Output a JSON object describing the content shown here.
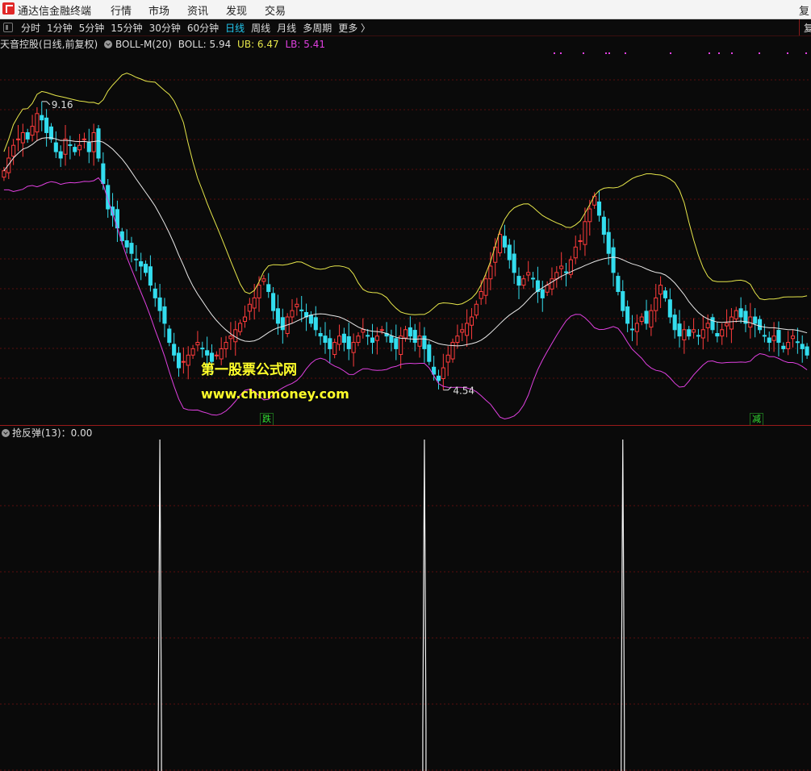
{
  "menu": {
    "app_title": "通达信金融终端",
    "items": [
      "行情",
      "市场",
      "资讯",
      "发现",
      "交易"
    ],
    "right_edge": "复"
  },
  "periods": {
    "items": [
      "分时",
      "1分钟",
      "5分钟",
      "15分钟",
      "30分钟",
      "60分钟",
      "日线",
      "周线",
      "月线",
      "多周期",
      "更多 〉"
    ],
    "active": "日线",
    "right_mark": "复"
  },
  "main": {
    "stock_label": "天音控股(日线,前复权)",
    "indicator": "BOLL-M(20)",
    "boll": "BOLL: 5.94",
    "ub": "UB: 6.47",
    "lb": "LB: 5.41",
    "high_label": "9.16",
    "low_label": "4.54",
    "signal_a": "跌",
    "signal_b": "减",
    "colors": {
      "up": "#ff3c3c",
      "down": "#33ddee",
      "mid": "#e8e8e8",
      "ub": "#e6e64a",
      "lb": "#e040e0",
      "grid": "#5a0f0f"
    }
  },
  "watermark": {
    "line1": "第一股票公式网",
    "line2": "www.chnmoney.com"
  },
  "sub_indicator": {
    "label": "抢反弹(13)：0.00"
  },
  "chart_data": {
    "type": "candlestick",
    "title": "天音控股(日线,前复权)",
    "indicator": "BOLL-M(20)",
    "last_values": {
      "BOLL": 5.94,
      "UB": 6.47,
      "LB": 5.41
    },
    "marked_high": 9.16,
    "marked_low": 4.54,
    "ylim": [
      4.0,
      9.9
    ],
    "close": [
      8.0,
      8.2,
      8.4,
      8.5,
      8.6,
      8.5,
      8.7,
      8.9,
      8.8,
      8.6,
      8.5,
      8.3,
      8.2,
      8.5,
      8.4,
      8.3,
      8.4,
      8.5,
      8.3,
      8.6,
      8.2,
      7.8,
      7.4,
      7.3,
      7.1,
      6.9,
      6.8,
      6.7,
      6.6,
      6.5,
      6.4,
      6.2,
      6.0,
      5.8,
      5.6,
      5.3,
      5.1,
      4.9,
      5.0,
      5.1,
      5.2,
      5.3,
      5.2,
      5.1,
      5.0,
      5.1,
      5.2,
      5.3,
      5.4,
      5.5,
      5.6,
      5.7,
      5.9,
      6.0,
      6.2,
      6.3,
      6.1,
      5.8,
      5.6,
      5.5,
      5.7,
      5.8,
      5.9,
      5.8,
      5.7,
      5.6,
      5.5,
      5.4,
      5.3,
      5.2,
      5.3,
      5.4,
      5.3,
      5.2,
      5.3,
      5.4,
      5.5,
      5.4,
      5.3,
      5.4,
      5.5,
      5.4,
      5.3,
      5.2,
      5.4,
      5.5,
      5.4,
      5.3,
      5.4,
      5.2,
      5.0,
      4.8,
      4.7,
      4.9,
      5.1,
      5.3,
      5.4,
      5.5,
      5.6,
      5.7,
      5.9,
      6.1,
      6.3,
      6.5,
      6.8,
      7.0,
      6.8,
      6.6,
      6.4,
      6.2,
      6.3,
      6.4,
      6.3,
      6.1,
      6.0,
      6.2,
      6.3,
      6.4,
      6.5,
      6.4,
      6.6,
      6.8,
      6.9,
      7.2,
      7.4,
      7.6,
      7.3,
      7.0,
      6.7,
      6.4,
      6.1,
      5.8,
      5.6,
      5.5,
      5.6,
      5.7,
      5.6,
      5.8,
      6.0,
      6.2,
      6.0,
      5.7,
      5.5,
      5.4,
      5.5,
      5.4,
      5.5,
      5.4,
      5.5,
      5.6,
      5.5,
      5.4,
      5.5,
      5.6,
      5.7,
      5.8,
      5.7,
      5.6,
      5.7,
      5.6,
      5.5,
      5.4,
      5.3,
      5.4,
      5.3,
      5.2,
      5.3,
      5.4,
      5.3,
      5.2,
      5.1
    ],
    "signals": [
      {
        "label": "跌",
        "x_index": 58
      },
      {
        "label": "减",
        "x_index": 160
      }
    ],
    "sub_indicator": {
      "name": "抢反弹(13)",
      "value": 0.0,
      "spikes_at_index": [
        33,
        89,
        131
      ]
    }
  }
}
